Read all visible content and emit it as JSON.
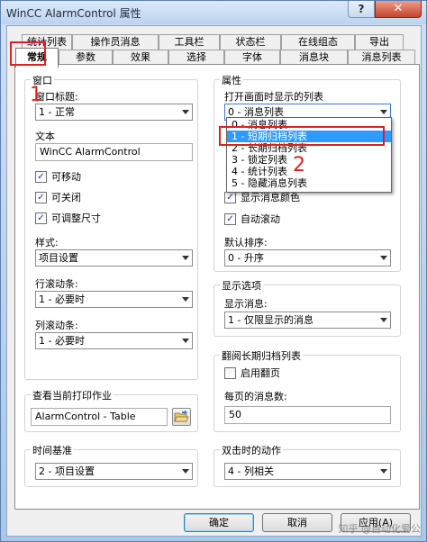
{
  "window": {
    "title": "WinCC AlarmControl 属性",
    "help_label": "?",
    "close_label": "✕"
  },
  "tabs_back": [
    "统计列表",
    "操作员消息",
    "工具栏",
    "状态栏",
    "在线组态",
    "导出"
  ],
  "tabs_front": [
    "常规",
    "参数",
    "效果",
    "选择",
    "字体",
    "消息块",
    "消息列表"
  ],
  "window_group": {
    "title": "窗口",
    "caption_label": "窗口标题:",
    "caption_value": "1 - 正常",
    "text_label": "文本",
    "text_value": "WinCC AlarmControl",
    "checkboxes": [
      {
        "label": "可移动",
        "checked": true
      },
      {
        "label": "可关闭",
        "checked": true
      },
      {
        "label": "可调整尺寸",
        "checked": true
      }
    ],
    "style_label": "样式:",
    "style_value": "项目设置",
    "row_scroll_label": "行滚动条:",
    "row_scroll_value": "1 - 必要时",
    "col_scroll_label": "列滚动条:",
    "col_scroll_value": "1 - 必要时"
  },
  "print_group": {
    "title": "查看当前打印作业",
    "value": "AlarmControl - Table"
  },
  "timebase_group": {
    "title": "时间基准",
    "value": "2 - 项目设置"
  },
  "properties_group": {
    "title": "属性",
    "open_list_label": "打开画面时显示的列表",
    "open_list_value": "0 - 消息列表",
    "dropdown_options": [
      "0 - 消息列表",
      "1 - 短期归档列表",
      "2 - 长期归档列表",
      "3 - 锁定列表",
      "4 - 统计列表",
      "5 - 隐藏消息列表"
    ],
    "dropdown_selected_index": 1,
    "show_color_label": "显示消息颜色",
    "show_color_checked": true,
    "autoscroll_label": "自动滚动",
    "autoscroll_checked": true,
    "sort_label": "默认排序:",
    "sort_value": "0 - 升序"
  },
  "display_group": {
    "title": "显示选项",
    "show_msg_label": "显示消息:",
    "show_msg_value": "1 - 仅限显示的消息"
  },
  "longterm_group": {
    "title": "翻阅长期归档列表",
    "paging_label": "启用翻页",
    "paging_checked": false,
    "per_page_label": "每页的消息数:",
    "per_page_value": "50"
  },
  "dblclick_group": {
    "title": "双击时的动作",
    "value": "4 - 列相关"
  },
  "annotations": {
    "num1": "1",
    "num2": "2"
  },
  "buttons": {
    "ok": "确定",
    "cancel": "取消",
    "apply": "应用(A)"
  },
  "watermark": "知乎 @自动化爱公"
}
